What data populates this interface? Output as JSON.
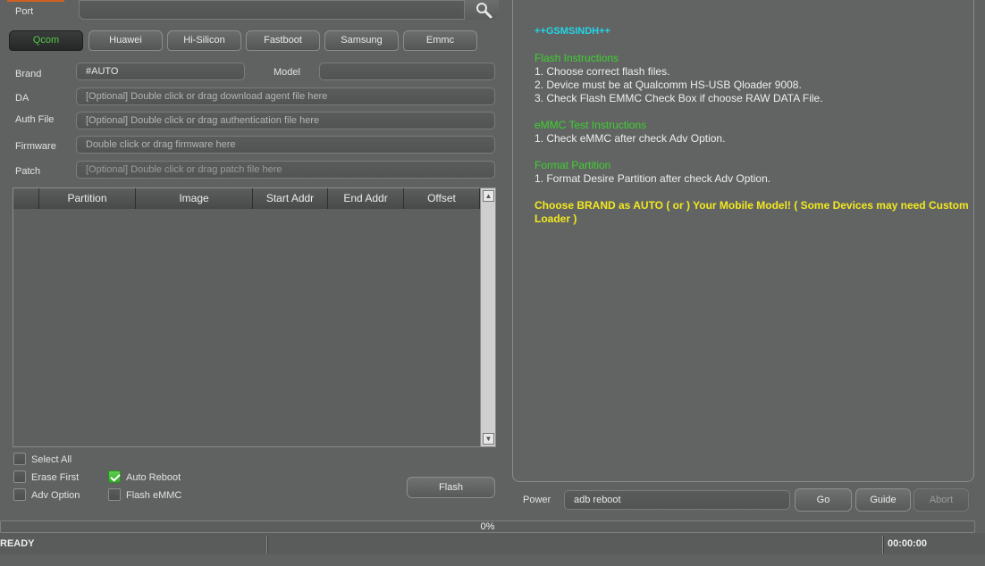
{
  "port": {
    "label": "Port",
    "value": ""
  },
  "tabs": [
    "Qcom",
    "Huawei",
    "Hi-Silicon",
    "Fastboot",
    "Samsung",
    "Emmc"
  ],
  "active_tab": "Qcom",
  "form": {
    "brand_label": "Brand",
    "brand_value": "#AUTO",
    "model_label": "Model",
    "model_value": "",
    "da_label": "DA",
    "da_placeholder": "[Optional] Double click or drag download agent file here",
    "auth_label": "Auth File",
    "auth_placeholder": "[Optional] Double click or drag authentication file here",
    "firmware_label": "Firmware",
    "firmware_placeholder": "Double click or drag firmware here",
    "patch_label": "Patch",
    "patch_placeholder": "[Optional] Double click or drag patch file here"
  },
  "table": {
    "columns": [
      "",
      "Partition",
      "Image",
      "Start Addr",
      "End Addr",
      "Offset"
    ],
    "rows": []
  },
  "options": {
    "select_all": "Select All",
    "erase_first": "Erase First",
    "auto_reboot": "Auto Reboot",
    "adv_option": "Adv Option",
    "flash_emmc": "Flash eMMC",
    "auto_reboot_checked": true
  },
  "flash_button": "Flash",
  "info": {
    "header": "++GSMSINDH++",
    "flash_title": "Flash Instructions",
    "flash_lines": [
      "1. Choose correct flash files.",
      "2. Device must be at Qualcomm HS-USB Qloader 9008.",
      "3. Check Flash EMMC Check Box if choose RAW DATA File."
    ],
    "emmc_title": "eMMC Test Instructions",
    "emmc_lines": [
      "1. Check eMMC after check Adv Option."
    ],
    "format_title": "Format Partition",
    "format_lines": [
      "1. Format Desire Partition after check Adv Option."
    ],
    "warning_line1": "Choose BRAND as AUTO ( or ) Your Mobile Model! ( Some Devices may need Custom",
    "warning_line2": "Loader )"
  },
  "power": {
    "label": "Power",
    "value": "adb reboot",
    "go": "Go",
    "guide": "Guide",
    "abort": "Abort"
  },
  "progress": {
    "text": "0%",
    "value": 0
  },
  "status": {
    "text": "READY",
    "time": "00:00:00"
  },
  "colors": {
    "active_tab_text": "#52c847",
    "green_heading": "#3ed12f",
    "cyan_header": "#21d6e6",
    "yellow_warning": "#f2e81f"
  }
}
